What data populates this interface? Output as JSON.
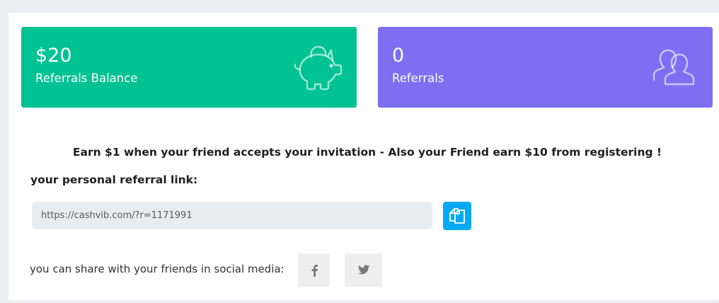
{
  "cards": [
    {
      "value": "$20",
      "label": "Referrals Balance",
      "icon": "piggy-bank-icon",
      "color": "#00c292"
    },
    {
      "value": "0",
      "label": "Referrals",
      "icon": "users-icon",
      "color": "#7d6ef2"
    }
  ],
  "invite": {
    "headline": "Earn $1 when your friend accepts your invitation - Also your Friend earn $10 from registering !",
    "link_label": "your personal referral link:",
    "link_value": "https://cashvib.com/?r=1171991",
    "copy_icon": "copy-icon",
    "copy_color": "#03a9f3"
  },
  "share": {
    "label": "you can share with your friends in social media:",
    "buttons": [
      {
        "icon": "facebook-icon",
        "letter": "f"
      },
      {
        "icon": "twitter-icon"
      }
    ]
  }
}
